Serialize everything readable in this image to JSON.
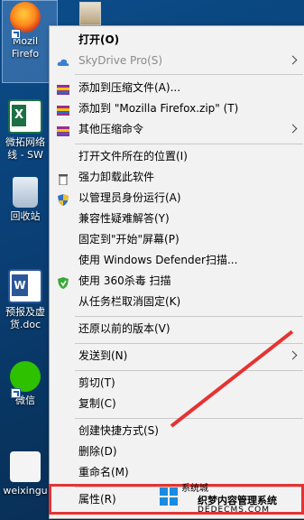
{
  "desktop": {
    "icons": [
      {
        "label_line1": "Mozil",
        "label_line2": "Firefo"
      },
      {
        "label_line1": "微拓网络",
        "label_line2": "线 - SW"
      },
      {
        "label_line1": "回收站",
        "label_line2": ""
      },
      {
        "label_line1": "预报及虚",
        "label_line2": "货.doc"
      },
      {
        "label_line1": "微信",
        "label_line2": ""
      },
      {
        "label_line1": "weixingu",
        "label_line2": ""
      }
    ]
  },
  "menu": {
    "items": [
      {
        "label": "打开(O)",
        "icon": "none",
        "bold": true
      },
      {
        "label": "SkyDrive Pro(S)",
        "icon": "cloud-icon",
        "disabled": true,
        "submenu": true
      },
      {
        "label": "添加到压缩文件(A)...",
        "icon": "archive-icon"
      },
      {
        "label": "添加到 \"Mozilla Firefox.zip\" (T)",
        "icon": "archive-icon"
      },
      {
        "label": "其他压缩命令",
        "icon": "archive-icon",
        "submenu": true
      },
      {
        "label": "打开文件所在的位置(I)",
        "icon": "none"
      },
      {
        "label": "强力卸载此软件",
        "icon": "trash-icon"
      },
      {
        "label": "以管理员身份运行(A)",
        "icon": "shield-icon"
      },
      {
        "label": "兼容性疑难解答(Y)",
        "icon": "none"
      },
      {
        "label": "固定到\"开始\"屏幕(P)",
        "icon": "none"
      },
      {
        "label": "使用 Windows Defender扫描...",
        "icon": "none"
      },
      {
        "label": "使用 360杀毒 扫描",
        "icon": "360-icon"
      },
      {
        "label": "从任务栏取消固定(K)",
        "icon": "none"
      },
      {
        "label": "还原以前的版本(V)",
        "icon": "none"
      },
      {
        "label": "发送到(N)",
        "icon": "none",
        "submenu": true
      },
      {
        "label": "剪切(T)",
        "icon": "none"
      },
      {
        "label": "复制(C)",
        "icon": "none"
      },
      {
        "label": "创建快捷方式(S)",
        "icon": "none"
      },
      {
        "label": "删除(D)",
        "icon": "none"
      },
      {
        "label": "重命名(M)",
        "icon": "none"
      },
      {
        "label": "属性(R)",
        "icon": "none"
      }
    ]
  },
  "watermark": {
    "line1": "系统城",
    "line2": "织梦内容管理系统",
    "line3": "DEDECMS.COM"
  },
  "colors": {
    "highlight": "#e53333",
    "menu_bg": "#f2f2f2",
    "desktop": "#0a3f75"
  }
}
